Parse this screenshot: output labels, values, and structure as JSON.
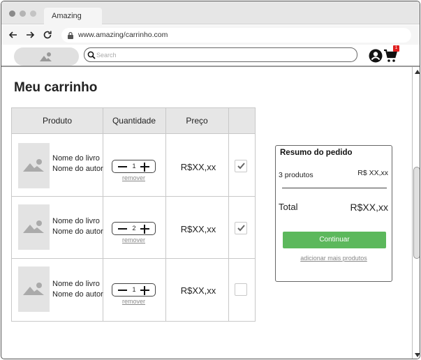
{
  "browser": {
    "tab_title": "Amazing",
    "url": "www.amazing/carrinho.com"
  },
  "header": {
    "search_placeholder": "Search",
    "cart_badge": "1"
  },
  "page": {
    "title": "Meu carrinho"
  },
  "table": {
    "headers": [
      "Produto",
      "Quantidade",
      "Preço",
      ""
    ],
    "rows": [
      {
        "title": "Nome do livro",
        "author": "Nome do autor",
        "qty": "1",
        "remove": "remover",
        "price": "R$XX,xx",
        "checked": true
      },
      {
        "title": "Nome do livro",
        "author": "Nome do autor",
        "qty": "2",
        "remove": "remover",
        "price": "R$XX,xx",
        "checked": true
      },
      {
        "title": "Nome do livro",
        "author": "Nome do autor",
        "qty": "1",
        "remove": "remover",
        "price": "R$XX,xx",
        "checked": false
      }
    ]
  },
  "summary": {
    "title": "Resumo do pedido",
    "count_label": "3 produtos",
    "subtotal": "R$ XX,xx",
    "total_label": "Total",
    "total": "R$XX,xx",
    "continue_label": "Continuar",
    "more_link": "adicionar mais produtos"
  },
  "colors": {
    "continue_button": "#5cb85c",
    "badge": "#e02020"
  }
}
